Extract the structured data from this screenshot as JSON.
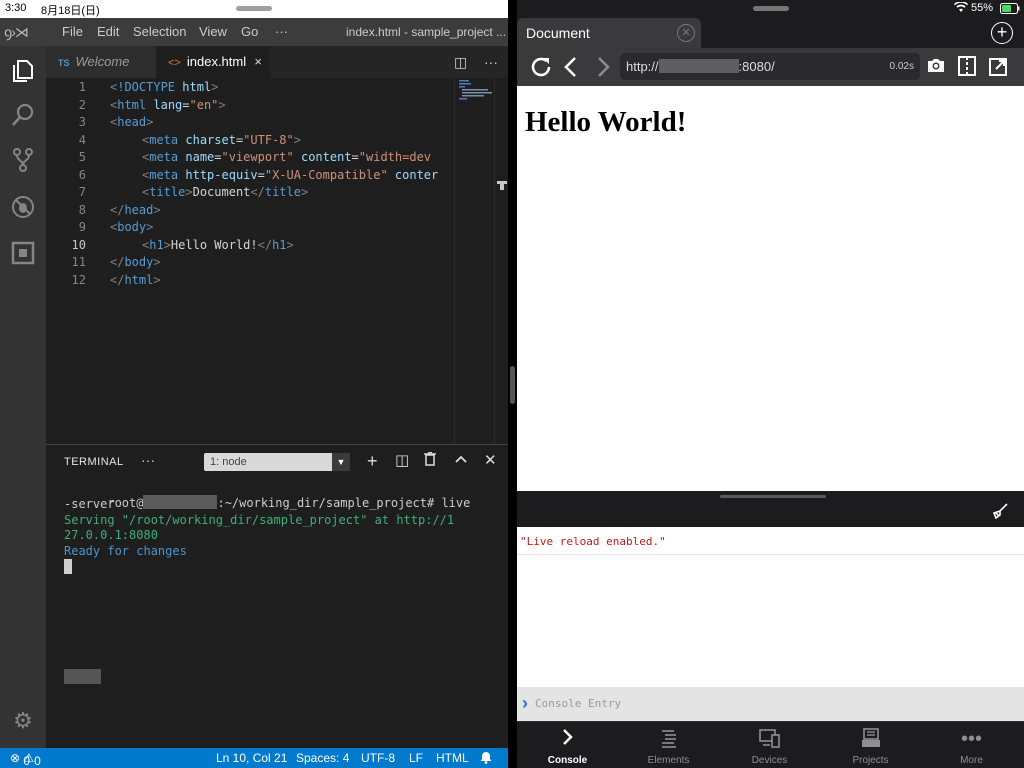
{
  "ios_status": {
    "time": "3:30",
    "date": "8月18日(日)",
    "wifi_icon": "wifi-icon",
    "battery": "55%"
  },
  "editor": {
    "menu": [
      "File",
      "Edit",
      "Selection",
      "View",
      "Go",
      "···"
    ],
    "window_title": "index.html - sample_project ...",
    "tabs": [
      {
        "prefix": "TS",
        "label": "Welcome"
      },
      {
        "prefix": "<>",
        "label": "index.html",
        "close": "×"
      }
    ],
    "line_numbers": [
      "1",
      "2",
      "3",
      "4",
      "5",
      "6",
      "7",
      "8",
      "9",
      "10",
      "11",
      "12"
    ],
    "current_line": "10",
    "code_lines": [
      "<!DOCTYPE html>",
      "<html lang=\"en\">",
      "<head>",
      "<meta charset=\"UTF-8\">",
      "<meta name=\"viewport\" content=\"width=dev",
      "<meta http-equiv=\"X-UA-Compatible\" conter",
      "<title>Document</title>",
      "</head>",
      "<body>",
      "<h1>Hello World!</h1>",
      "</body>",
      "</html>"
    ]
  },
  "terminal": {
    "title": "TERMINAL",
    "more": "···",
    "selected_shell": "1: node",
    "lines": [
      {
        "user": "root@",
        "path": ":~/working_dir/sample_project#",
        "cmd": " live"
      },
      {
        "text": "-server"
      },
      {
        "text": "Serving \"/root/working_dir/sample_project\" at http://1"
      },
      {
        "text": "27.0.0.1:8080"
      },
      {
        "text": "Ready for changes"
      }
    ]
  },
  "statusbar": {
    "errors": "0",
    "warnings": "0",
    "position": "Ln 10, Col 21",
    "spaces": "Spaces: 4",
    "encoding": "UTF-8",
    "eol": "LF",
    "language": "HTML"
  },
  "browser": {
    "tab_title": "Document",
    "url_prefix": "http://",
    "url_suffix": ":8080/",
    "load_time": "0.02s",
    "page_heading": "Hello World!"
  },
  "console": {
    "messages": [
      "\"Live reload enabled.\""
    ],
    "entry_placeholder": "Console Entry"
  },
  "bottom_tabs": [
    {
      "label": "Console",
      "icon": "chevron-right-icon",
      "active": true
    },
    {
      "label": "Elements",
      "icon": "elements-icon",
      "active": false
    },
    {
      "label": "Devices",
      "icon": "devices-icon",
      "active": false
    },
    {
      "label": "Projects",
      "icon": "projects-icon",
      "active": false
    },
    {
      "label": "More",
      "icon": "more-icon",
      "active": false
    }
  ],
  "colors": {
    "accent": "#007acc",
    "editor_bg": "#1e1e1e",
    "console_log_text": "#c41a16",
    "terminal_green": "#3bb07a",
    "terminal_blue": "#4e94ce"
  }
}
